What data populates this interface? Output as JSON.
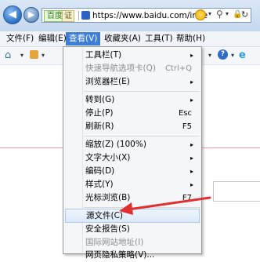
{
  "address_bar": {
    "back_glyph": "◀",
    "forward_glyph": "▶",
    "site_badge": "百度",
    "cert_badge": "证",
    "url": "https://www.baidu.com/inde",
    "dropdown_glyph": "▾",
    "search_glyph": "⚲",
    "lock_glyph": "🔒",
    "refresh_glyph": "↻"
  },
  "menubar": {
    "items": [
      {
        "label": "文件(F)",
        "active": false
      },
      {
        "label": "编辑(E)",
        "active": false
      },
      {
        "label": "查看(V)",
        "active": true
      },
      {
        "label": "收藏夹(A)",
        "active": false
      },
      {
        "label": "工具(T)",
        "active": false
      },
      {
        "label": "帮助(H)",
        "active": false
      }
    ]
  },
  "command_bar": {
    "home_glyph": "⌂",
    "dropdown_glyph": "▾",
    "help_glyph": "?",
    "ie_glyph": "e"
  },
  "view_menu": {
    "items": [
      {
        "label": "工具栏(T)",
        "submenu": true
      },
      {
        "label": "快速导航选项卡(Q)",
        "shortcut": "Ctrl+Q",
        "disabled": true
      },
      {
        "label": "浏览器栏(E)",
        "submenu": true
      },
      {
        "separator": true
      },
      {
        "label": "转到(G)",
        "submenu": true
      },
      {
        "label": "停止(P)",
        "shortcut": "Esc"
      },
      {
        "label": "刷新(R)",
        "shortcut": "F5"
      },
      {
        "separator": true
      },
      {
        "label": "缩放(Z) (100%)",
        "submenu": true
      },
      {
        "label": "文字大小(X)",
        "submenu": true
      },
      {
        "label": "编码(D)",
        "submenu": true
      },
      {
        "label": "样式(Y)",
        "submenu": true
      },
      {
        "label": "光标浏览(B)",
        "shortcut": "F7"
      },
      {
        "separator": true
      },
      {
        "label": "源文件(C)",
        "highlighted": true
      },
      {
        "label": "安全报告(S)"
      },
      {
        "label": "国际网站地址(I)",
        "disabled": true
      },
      {
        "label": "网页隐私策略(V)..."
      }
    ],
    "submenu_glyph": "▸"
  },
  "colors": {
    "menu_active": "#3c7fd4",
    "annotation_arrow": "#e03030",
    "disabled_text": "#8d8d8d"
  }
}
